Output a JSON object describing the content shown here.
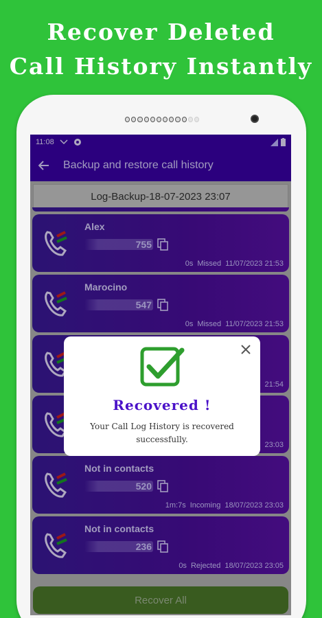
{
  "headline": {
    "line1": "Recover Deleted",
    "line2": "Call History Instantly"
  },
  "statusbar": {
    "time": "11:08"
  },
  "appbar": {
    "title": "Backup and restore call history"
  },
  "backup": {
    "label": "Log-Backup-18-07-2023 23:07"
  },
  "calls": [
    {
      "name": "Alex",
      "number": "755",
      "duration": "0s",
      "type": "Missed",
      "datetime": "11/07/2023 21:53"
    },
    {
      "name": "Marocino",
      "number": "547",
      "duration": "0s",
      "type": "Missed",
      "datetime": "11/07/2023 21:53"
    },
    {
      "name": "",
      "number": "",
      "duration": "",
      "type": "",
      "datetime": "21:54"
    },
    {
      "name": "",
      "number": "",
      "duration": "",
      "type": "",
      "datetime": "23:03"
    },
    {
      "name": "Not in contacts",
      "number": "520",
      "duration": "1m:7s",
      "type": "Incoming",
      "datetime": "18/07/2023 23:03"
    },
    {
      "name": "Not in contacts",
      "number": "236",
      "duration": "0s",
      "type": "Rejected",
      "datetime": "18/07/2023 23:05"
    }
  ],
  "recover_all": {
    "label": "Recover All"
  },
  "dialog": {
    "title": "Recovered !",
    "message": "Your Call Log History is recovered successfully."
  },
  "colors": {
    "background": "#2fc33a",
    "appbar": "#3a00a8",
    "dialog_title": "#4b12c8",
    "check": "#2e9e2e"
  },
  "icons": {
    "back": "arrow-left-icon",
    "phone": "phone-icon",
    "copy": "copy-icon",
    "close": "close-icon",
    "check": "check-box-icon"
  }
}
